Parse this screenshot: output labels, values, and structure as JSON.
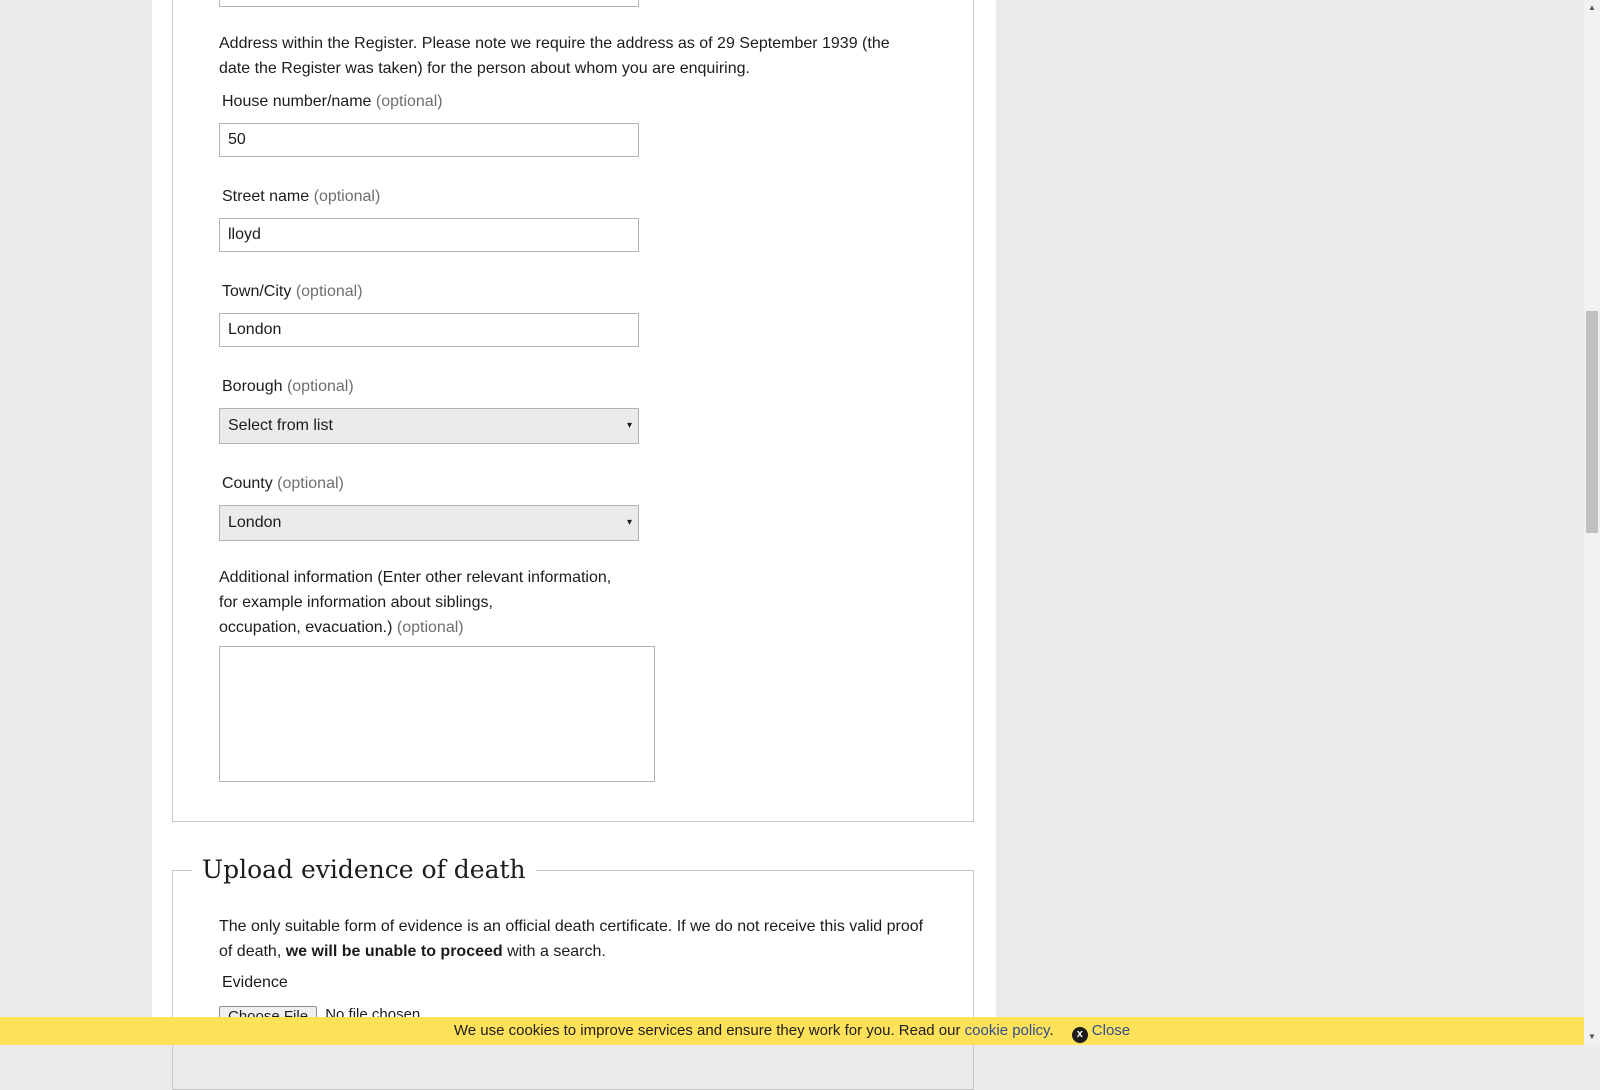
{
  "address_section": {
    "intro": "Address within the Register. Please note we require the address as of 29 September 1939 (the date the Register was taken) for the person about whom you are enquiring.",
    "optional_text": "(optional)",
    "house": {
      "label": "House number/name",
      "value": "50"
    },
    "street": {
      "label": "Street name",
      "value": "lloyd"
    },
    "town": {
      "label": "Town/City",
      "value": "London"
    },
    "borough": {
      "label": "Borough",
      "selected": "Select from list"
    },
    "county": {
      "label": "County",
      "selected": "London"
    },
    "additional": {
      "label_line1": "Additional information (Enter other relevant information,",
      "label_line2": "for example information about siblings,",
      "label_line3": "occupation, evacuation.)",
      "value": ""
    }
  },
  "evidence_section": {
    "legend": "Upload evidence of death",
    "text_part1": "The only suitable form of evidence is an official death certificate. If we do not receive this valid proof of death,",
    "text_bold": "we will be unable to proceed",
    "text_part2": "with a search.",
    "evidence_label": "Evidence",
    "choose_file_label": "Choose File",
    "file_status": "No file chosen"
  },
  "cookie_bar": {
    "message": "We use cookies to improve services and ensure they work for you. Read our",
    "link_text": "cookie policy",
    "period": ".",
    "close_icon_glyph": "x",
    "close_label": "Close",
    "background": "#ffe25a"
  },
  "icons": {
    "select_arrow": "▾",
    "scroll_up": "▲",
    "scroll_down": "▼"
  }
}
